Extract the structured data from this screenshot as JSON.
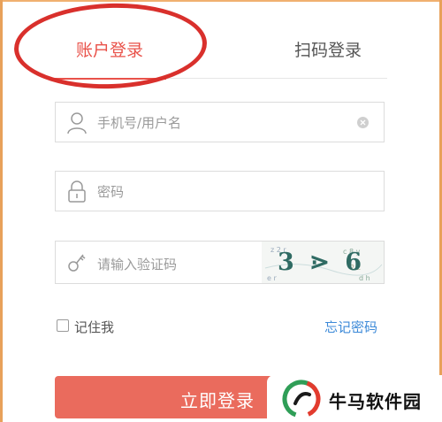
{
  "tabs": {
    "account_label": "账户登录",
    "qr_label": "扫码登录"
  },
  "form": {
    "username_placeholder": "手机号/用户名",
    "password_placeholder": "密码",
    "captcha_placeholder": "请输入验证码",
    "captcha_text": "3 ⋗ 6",
    "remember_label": "记住我",
    "forgot_label": "忘记密码",
    "login_label": "立即登录"
  },
  "watermark": {
    "text": "牛马软件园"
  },
  "colors": {
    "accent": "#e9524a",
    "button": "#ea6b5d",
    "link": "#3d8ad8",
    "annotation": "#d9302c"
  }
}
